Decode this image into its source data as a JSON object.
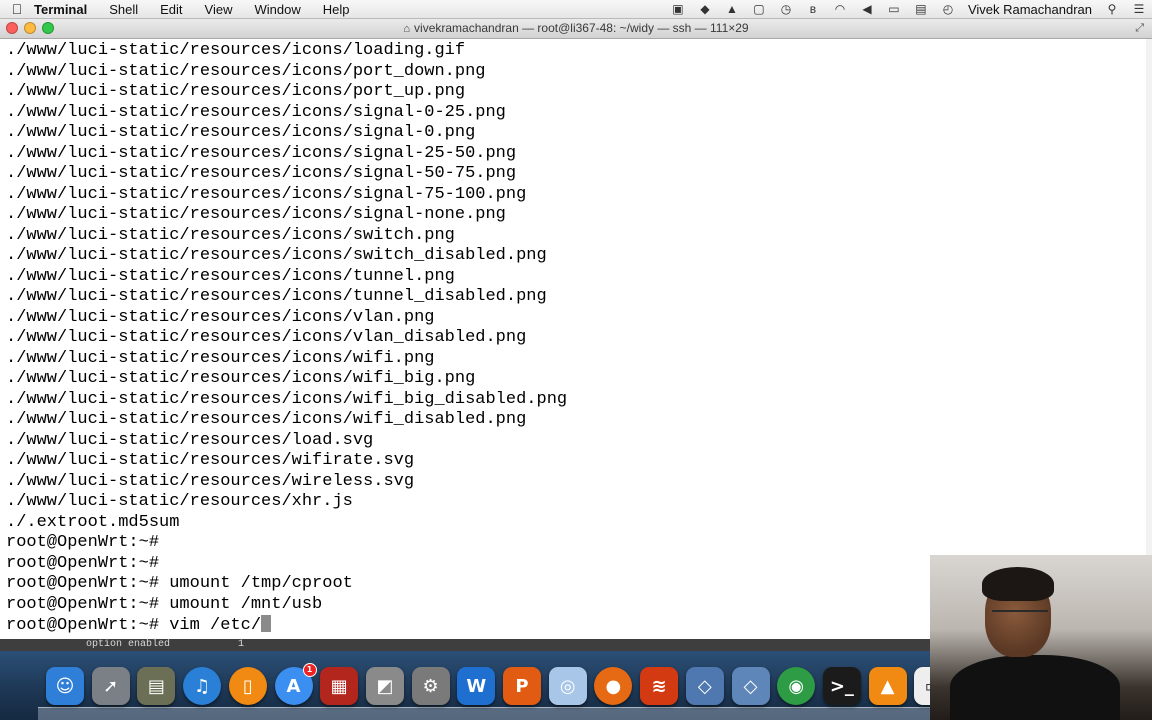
{
  "menubar": {
    "app_name": "Terminal",
    "menus": [
      "Shell",
      "Edit",
      "View",
      "Window",
      "Help"
    ],
    "user_name": "Vivek Ramachandran"
  },
  "window": {
    "title": "vivekramachandran — root@li367-48: ~/widy — ssh — 111×29"
  },
  "terminal": {
    "lines": [
      "./www/luci-static/resources/icons/loading.gif",
      "./www/luci-static/resources/icons/port_down.png",
      "./www/luci-static/resources/icons/port_up.png",
      "./www/luci-static/resources/icons/signal-0-25.png",
      "./www/luci-static/resources/icons/signal-0.png",
      "./www/luci-static/resources/icons/signal-25-50.png",
      "./www/luci-static/resources/icons/signal-50-75.png",
      "./www/luci-static/resources/icons/signal-75-100.png",
      "./www/luci-static/resources/icons/signal-none.png",
      "./www/luci-static/resources/icons/switch.png",
      "./www/luci-static/resources/icons/switch_disabled.png",
      "./www/luci-static/resources/icons/tunnel.png",
      "./www/luci-static/resources/icons/tunnel_disabled.png",
      "./www/luci-static/resources/icons/vlan.png",
      "./www/luci-static/resources/icons/vlan_disabled.png",
      "./www/luci-static/resources/icons/wifi.png",
      "./www/luci-static/resources/icons/wifi_big.png",
      "./www/luci-static/resources/icons/wifi_big_disabled.png",
      "./www/luci-static/resources/icons/wifi_disabled.png",
      "./www/luci-static/resources/load.svg",
      "./www/luci-static/resources/wifirate.svg",
      "./www/luci-static/resources/wireless.svg",
      "./www/luci-static/resources/xhr.js",
      "./.extroot.md5sum",
      "root@OpenWrt:~#",
      "root@OpenWrt:~#",
      "root@OpenWrt:~# umount /tmp/cproot",
      "root@OpenWrt:~# umount /mnt/usb"
    ],
    "prompt": "root@OpenWrt:~# ",
    "current_input": "vim /etc/"
  },
  "statusbar": {
    "left_text": "option enabled",
    "right_text": "1"
  },
  "dock": {
    "items": [
      {
        "name": "finder-icon",
        "glyph": "☺",
        "color": "#2f7fd8"
      },
      {
        "name": "launchpad-icon",
        "glyph": "➚",
        "color": "#7b7f86"
      },
      {
        "name": "image-capture-icon",
        "glyph": "▤",
        "color": "#6b6f55"
      },
      {
        "name": "itunes-icon",
        "glyph": "♫",
        "color": "#2a7fd6"
      },
      {
        "name": "ibooks-icon",
        "glyph": "▯",
        "color": "#f08a12"
      },
      {
        "name": "app-store-icon",
        "glyph": "A",
        "color": "#3a8ff0",
        "badge": "1"
      },
      {
        "name": "photo-booth-icon",
        "glyph": "▦",
        "color": "#b3261e"
      },
      {
        "name": "preview-icon",
        "glyph": "◩",
        "color": "#8a8a8a"
      },
      {
        "name": "system-preferences-icon",
        "glyph": "⚙",
        "color": "#7a7a7a"
      },
      {
        "name": "word-icon",
        "glyph": "W",
        "color": "#1e6fd0"
      },
      {
        "name": "powerpoint-icon",
        "glyph": "P",
        "color": "#e25b12"
      },
      {
        "name": "preview-viewer-icon",
        "glyph": "◎",
        "color": "#a8c6e8"
      },
      {
        "name": "firefox-icon",
        "glyph": "●",
        "color": "#e66a13"
      },
      {
        "name": "flashcards-icon",
        "glyph": "≋",
        "color": "#d43a12"
      },
      {
        "name": "virtualbox-icon",
        "glyph": "◇",
        "color": "#4f78b0"
      },
      {
        "name": "virtualbox-vm-icon",
        "glyph": "◇",
        "color": "#5f86b8"
      },
      {
        "name": "chrome-icon",
        "glyph": "◉",
        "color": "#2e9b45"
      },
      {
        "name": "terminal-icon",
        "glyph": ">_",
        "color": "#1b1b1b"
      },
      {
        "name": "vlc-icon",
        "glyph": "▲",
        "color": "#f08a12"
      },
      {
        "name": "screen-icon",
        "glyph": "▭",
        "color": "#eeeeee"
      },
      {
        "name": "dvd-player-icon",
        "glyph": "◈",
        "color": "#555555"
      }
    ]
  }
}
